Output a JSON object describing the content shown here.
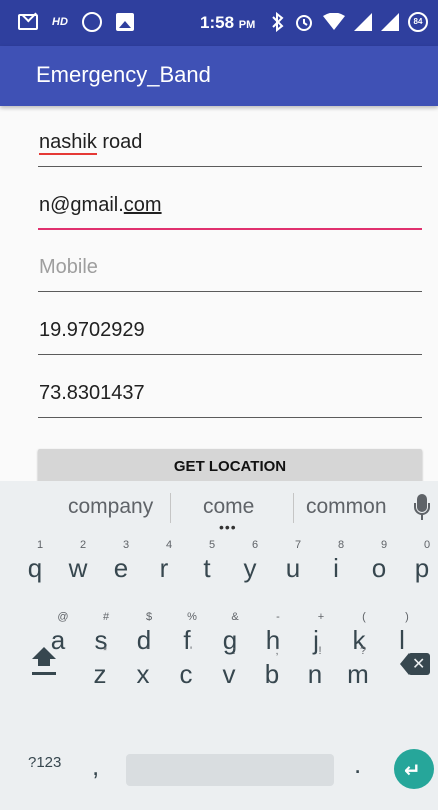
{
  "status_bar": {
    "time": "1:58",
    "time_suffix": "PM",
    "hd_label": "HD",
    "battery_level": "84"
  },
  "app_bar": {
    "title": "Emergency_Band"
  },
  "form": {
    "address": {
      "value_underlined": "nashik",
      "value_rest": " road"
    },
    "email": {
      "value_prefix": "n@gmail.",
      "value_underlined": "com"
    },
    "mobile": {
      "placeholder": "Mobile",
      "value": ""
    },
    "latitude": {
      "value": "19.9702929"
    },
    "longitude": {
      "value": "73.8301437"
    },
    "get_location_label": "GET LOCATION"
  },
  "keyboard": {
    "suggestions": [
      "company",
      "come",
      "common"
    ],
    "more_indicator": "•••",
    "row1": [
      {
        "key": "q",
        "hint": "1"
      },
      {
        "key": "w",
        "hint": "2"
      },
      {
        "key": "e",
        "hint": "3"
      },
      {
        "key": "r",
        "hint": "4"
      },
      {
        "key": "t",
        "hint": "5"
      },
      {
        "key": "y",
        "hint": "6"
      },
      {
        "key": "u",
        "hint": "7"
      },
      {
        "key": "i",
        "hint": "8"
      },
      {
        "key": "o",
        "hint": "9"
      },
      {
        "key": "p",
        "hint": "0"
      }
    ],
    "row2": [
      {
        "key": "a",
        "hint": "@"
      },
      {
        "key": "s",
        "hint": "#"
      },
      {
        "key": "d",
        "hint": "$"
      },
      {
        "key": "f",
        "hint": "%"
      },
      {
        "key": "g",
        "hint": "&"
      },
      {
        "key": "h",
        "hint": "-"
      },
      {
        "key": "j",
        "hint": "+"
      },
      {
        "key": "k",
        "hint": "("
      },
      {
        "key": "l",
        "hint": ")"
      }
    ],
    "row3": [
      {
        "key": "z",
        "hint": "*"
      },
      {
        "key": "x",
        "hint": "\""
      },
      {
        "key": "c",
        "hint": "'"
      },
      {
        "key": "v",
        "hint": ":"
      },
      {
        "key": "b",
        "hint": ";"
      },
      {
        "key": "n",
        "hint": "!"
      },
      {
        "key": "m",
        "hint": "?"
      }
    ],
    "symbols_label": "?123",
    "comma": ",",
    "period": ".",
    "backspace_symbol": "✕",
    "enter_symbol": "↵"
  },
  "colors": {
    "status_bar": "#2f3f9e",
    "app_bar": "#3f51b5",
    "focus_underline": "#e0306e",
    "enter_key": "#26a69a"
  }
}
